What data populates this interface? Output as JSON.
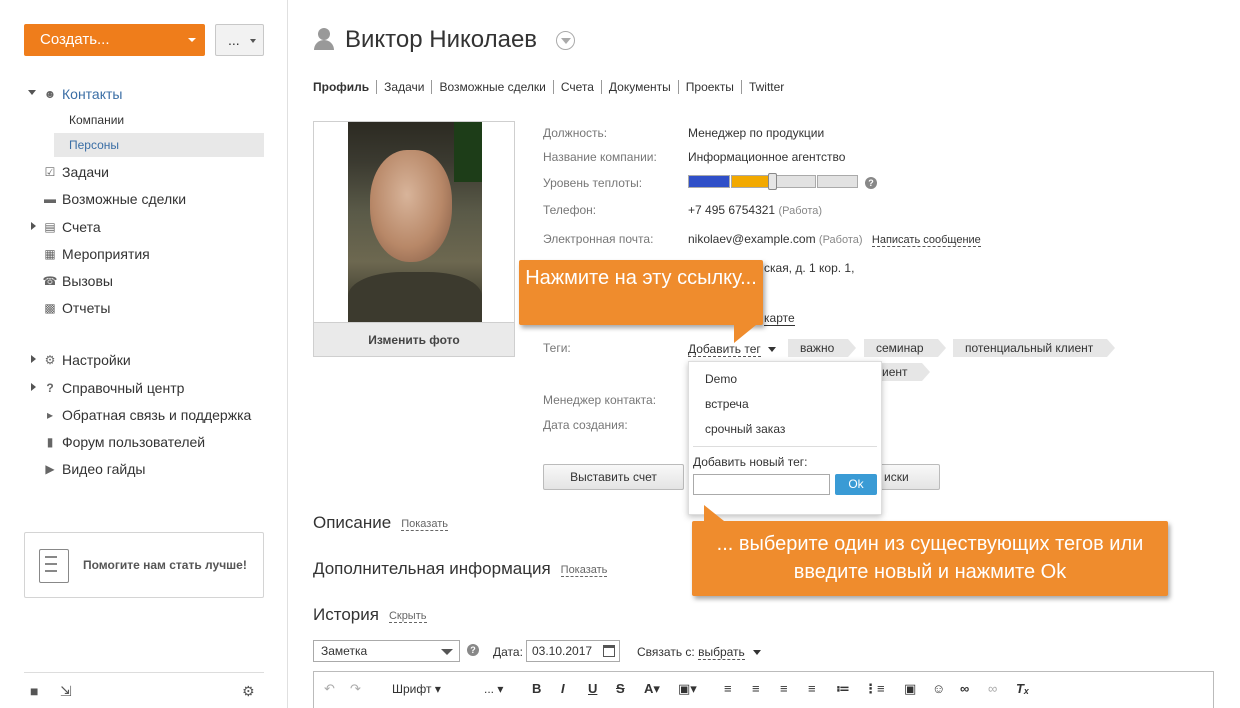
{
  "sidebar": {
    "create_label": "Создать...",
    "more_label": "...",
    "nav": [
      {
        "label": "Контакты",
        "icon": "contacts-icon"
      },
      {
        "label": "Задачи",
        "icon": "tasks-icon"
      },
      {
        "label": "Возможные сделки",
        "icon": "deals-icon"
      },
      {
        "label": "Счета",
        "icon": "invoices-icon"
      },
      {
        "label": "Мероприятия",
        "icon": "calendar-icon"
      },
      {
        "label": "Вызовы",
        "icon": "phone-icon"
      },
      {
        "label": "Отчеты",
        "icon": "reports-icon"
      }
    ],
    "contacts_sub": [
      "Компании",
      "Персоны"
    ],
    "nav2": [
      {
        "label": "Настройки",
        "icon": "gear-icon"
      },
      {
        "label": "Справочный центр",
        "icon": "question-icon"
      },
      {
        "label": "Обратная связь и поддержка",
        "icon": "megaphone-icon"
      },
      {
        "label": "Форум пользователей",
        "icon": "chat-icon"
      },
      {
        "label": "Видео гайды",
        "icon": "video-icon"
      }
    ],
    "help_box": "Помогите нам стать лучше!"
  },
  "header": {
    "name": "Виктор Николаев"
  },
  "tabs": [
    "Профиль",
    "Задачи",
    "Возможные сделки",
    "Счета",
    "Документы",
    "Проекты",
    "Twitter"
  ],
  "profile": {
    "change_photo": "Изменить фото",
    "labels": {
      "position": "Должность:",
      "company": "Название компании:",
      "warmth": "Уровень теплоты:",
      "phone": "Телефон:",
      "email": "Электронная почта:",
      "tags": "Теги:",
      "manager": "Менеджер контакта:",
      "created": "Дата создания:"
    },
    "position": "Менеджер по продукции",
    "company": "Информационное агентство",
    "warmth_level": 0.5,
    "phone": "+7 495 6754321",
    "phone_type": "(Работа)",
    "email": "nikolaev@example.com",
    "email_type": "(Работа)",
    "write_message": "Написать сообщение",
    "address_partial": "ская, д. 1 кор. 1,",
    "map_partial": "карте",
    "add_tag": "Добавить тег",
    "tags": [
      "важно",
      "семинар",
      "потенциальный клиент"
    ],
    "tag_partial": "иент",
    "invoice_button": "Выставить счет",
    "second_button_partial": "иски"
  },
  "tag_dropdown": {
    "options": [
      "Demo",
      "встреча",
      "срочный заказ"
    ],
    "new_tag_label": "Добавить новый тег:",
    "new_tag_value": "",
    "ok_label": "Ok"
  },
  "sections": {
    "description": "Описание",
    "additional": "Дополнительная информация",
    "show": "Показать",
    "history": "История",
    "hide": "Скрыть"
  },
  "history_form": {
    "type": "Заметка",
    "date_label": "Дата:",
    "date": "03.10.2017",
    "link_label": "Связать с:",
    "link_value": "выбрать"
  },
  "editor": {
    "font_label": "Шрифт",
    "size_label": "..."
  },
  "callouts": {
    "first": "Нажмите на эту ссылку...",
    "second": "... выберите один из существующих тегов или введите новый и нажмите Ok"
  },
  "colors": {
    "accent": "#ef7d1b",
    "callout": "#ef8c2d",
    "link": "#3a6ea5",
    "ok_button": "#3a9bd5",
    "meter_blue": "#2f4fc8",
    "meter_orange": "#f2a900"
  }
}
